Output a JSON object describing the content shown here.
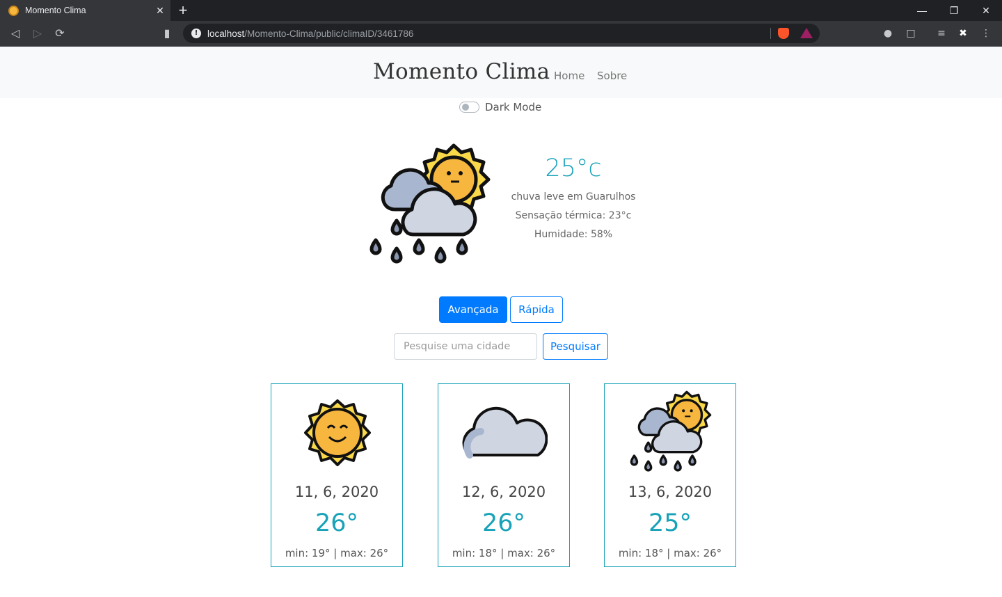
{
  "browser": {
    "tab_title": "Momento Clima",
    "tab_close": "✕",
    "new_tab": "+",
    "url_host": "localhost",
    "url_path": "/Momento-Clima/public/climaID/3461786"
  },
  "navbar": {
    "brand": "Momento Clima",
    "links": [
      "Home",
      "Sobre"
    ]
  },
  "dark_mode": {
    "label": "Dark Mode",
    "enabled": false
  },
  "current": {
    "temperature": "25°c",
    "description": "chuva leve em Guarulhos",
    "feels_like": "Sensação térmica: 23°c",
    "humidity": "Humidade: 58%",
    "icon": "sun-cloud-rain-icon"
  },
  "mode_buttons": {
    "advanced": "Avançada",
    "quick": "Rápida",
    "active": "advanced"
  },
  "search": {
    "placeholder": "Pesquise uma cidade",
    "value": "",
    "button": "Pesquisar"
  },
  "forecast": [
    {
      "date": "11, 6, 2020",
      "temp": "26°",
      "range": "min: 19° | max: 26°",
      "icon": "sun-icon"
    },
    {
      "date": "12, 6, 2020",
      "temp": "26°",
      "range": "min: 18° | max: 26°",
      "icon": "cloud-icon"
    },
    {
      "date": "13, 6, 2020",
      "temp": "25°",
      "range": "min: 18° | max: 26°",
      "icon": "sun-cloud-rain-icon"
    }
  ],
  "colors": {
    "accent": "#17a2b8",
    "primary": "#007bff",
    "navbar_bg": "#f8f9fa"
  }
}
